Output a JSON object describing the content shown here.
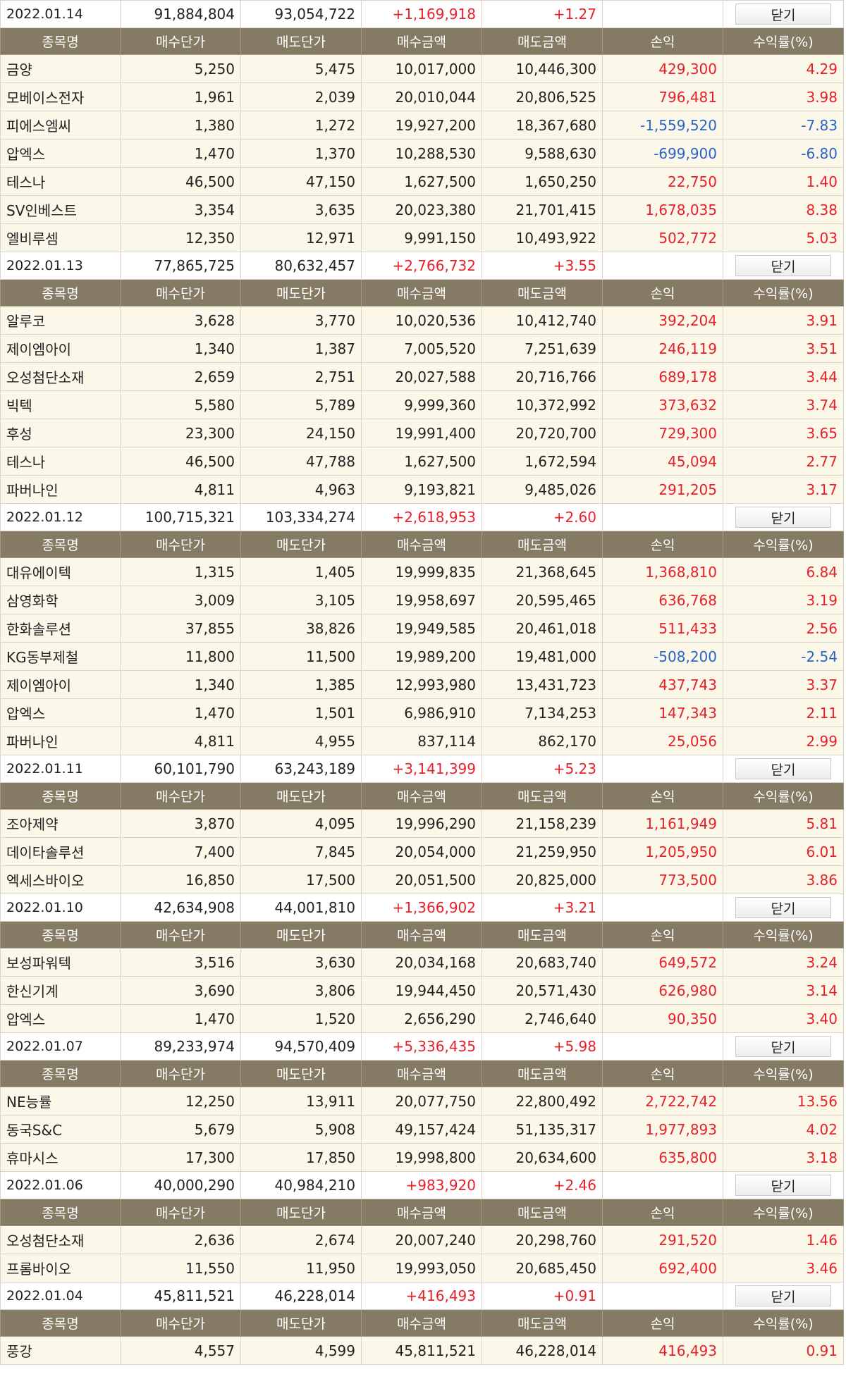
{
  "labels": {
    "close": "닫기",
    "headers": [
      "종목명",
      "매수단가",
      "매도단가",
      "매수금액",
      "매도금액",
      "손익",
      "수익률(%)"
    ]
  },
  "colors": {
    "positive": "#e8202a",
    "negative": "#2a64c8",
    "header_bg": "#857a63",
    "row_bg": "#fcf8e9"
  },
  "days": [
    {
      "date": "2022.01.14",
      "buy_total": "91,884,804",
      "sell_total": "93,054,722",
      "profit": "+1,169,918",
      "rate": "+1.27",
      "rows": [
        {
          "name": "금양",
          "buy_price": "5,250",
          "sell_price": "5,475",
          "buy_amount": "10,017,000",
          "sell_amount": "10,446,300",
          "profit": "429,300",
          "rate": "4.29"
        },
        {
          "name": "모베이스전자",
          "buy_price": "1,961",
          "sell_price": "2,039",
          "buy_amount": "20,010,044",
          "sell_amount": "20,806,525",
          "profit": "796,481",
          "rate": "3.98"
        },
        {
          "name": "피에스엠씨",
          "buy_price": "1,380",
          "sell_price": "1,272",
          "buy_amount": "19,927,200",
          "sell_amount": "18,367,680",
          "profit": "-1,559,520",
          "rate": "-7.83"
        },
        {
          "name": "압엑스",
          "buy_price": "1,470",
          "sell_price": "1,370",
          "buy_amount": "10,288,530",
          "sell_amount": "9,588,630",
          "profit": "-699,900",
          "rate": "-6.80"
        },
        {
          "name": "테스나",
          "buy_price": "46,500",
          "sell_price": "47,150",
          "buy_amount": "1,627,500",
          "sell_amount": "1,650,250",
          "profit": "22,750",
          "rate": "1.40"
        },
        {
          "name": "SV인베스트",
          "buy_price": "3,354",
          "sell_price": "3,635",
          "buy_amount": "20,023,380",
          "sell_amount": "21,701,415",
          "profit": "1,678,035",
          "rate": "8.38"
        },
        {
          "name": "엘비루셈",
          "buy_price": "12,350",
          "sell_price": "12,971",
          "buy_amount": "9,991,150",
          "sell_amount": "10,493,922",
          "profit": "502,772",
          "rate": "5.03"
        }
      ]
    },
    {
      "date": "2022.01.13",
      "buy_total": "77,865,725",
      "sell_total": "80,632,457",
      "profit": "+2,766,732",
      "rate": "+3.55",
      "rows": [
        {
          "name": "알루코",
          "buy_price": "3,628",
          "sell_price": "3,770",
          "buy_amount": "10,020,536",
          "sell_amount": "10,412,740",
          "profit": "392,204",
          "rate": "3.91"
        },
        {
          "name": "제이엠아이",
          "buy_price": "1,340",
          "sell_price": "1,387",
          "buy_amount": "7,005,520",
          "sell_amount": "7,251,639",
          "profit": "246,119",
          "rate": "3.51"
        },
        {
          "name": "오성첨단소재",
          "buy_price": "2,659",
          "sell_price": "2,751",
          "buy_amount": "20,027,588",
          "sell_amount": "20,716,766",
          "profit": "689,178",
          "rate": "3.44"
        },
        {
          "name": "빅텍",
          "buy_price": "5,580",
          "sell_price": "5,789",
          "buy_amount": "9,999,360",
          "sell_amount": "10,372,992",
          "profit": "373,632",
          "rate": "3.74"
        },
        {
          "name": "후성",
          "buy_price": "23,300",
          "sell_price": "24,150",
          "buy_amount": "19,991,400",
          "sell_amount": "20,720,700",
          "profit": "729,300",
          "rate": "3.65"
        },
        {
          "name": "테스나",
          "buy_price": "46,500",
          "sell_price": "47,788",
          "buy_amount": "1,627,500",
          "sell_amount": "1,672,594",
          "profit": "45,094",
          "rate": "2.77"
        },
        {
          "name": "파버나인",
          "buy_price": "4,811",
          "sell_price": "4,963",
          "buy_amount": "9,193,821",
          "sell_amount": "9,485,026",
          "profit": "291,205",
          "rate": "3.17"
        }
      ]
    },
    {
      "date": "2022.01.12",
      "buy_total": "100,715,321",
      "sell_total": "103,334,274",
      "profit": "+2,618,953",
      "rate": "+2.60",
      "rows": [
        {
          "name": "대유에이텍",
          "buy_price": "1,315",
          "sell_price": "1,405",
          "buy_amount": "19,999,835",
          "sell_amount": "21,368,645",
          "profit": "1,368,810",
          "rate": "6.84"
        },
        {
          "name": "삼영화학",
          "buy_price": "3,009",
          "sell_price": "3,105",
          "buy_amount": "19,958,697",
          "sell_amount": "20,595,465",
          "profit": "636,768",
          "rate": "3.19"
        },
        {
          "name": "한화솔루션",
          "buy_price": "37,855",
          "sell_price": "38,826",
          "buy_amount": "19,949,585",
          "sell_amount": "20,461,018",
          "profit": "511,433",
          "rate": "2.56"
        },
        {
          "name": "KG동부제철",
          "buy_price": "11,800",
          "sell_price": "11,500",
          "buy_amount": "19,989,200",
          "sell_amount": "19,481,000",
          "profit": "-508,200",
          "rate": "-2.54"
        },
        {
          "name": "제이엠아이",
          "buy_price": "1,340",
          "sell_price": "1,385",
          "buy_amount": "12,993,980",
          "sell_amount": "13,431,723",
          "profit": "437,743",
          "rate": "3.37"
        },
        {
          "name": "압엑스",
          "buy_price": "1,470",
          "sell_price": "1,501",
          "buy_amount": "6,986,910",
          "sell_amount": "7,134,253",
          "profit": "147,343",
          "rate": "2.11"
        },
        {
          "name": "파버나인",
          "buy_price": "4,811",
          "sell_price": "4,955",
          "buy_amount": "837,114",
          "sell_amount": "862,170",
          "profit": "25,056",
          "rate": "2.99"
        }
      ]
    },
    {
      "date": "2022.01.11",
      "buy_total": "60,101,790",
      "sell_total": "63,243,189",
      "profit": "+3,141,399",
      "rate": "+5.23",
      "rows": [
        {
          "name": "조아제약",
          "buy_price": "3,870",
          "sell_price": "4,095",
          "buy_amount": "19,996,290",
          "sell_amount": "21,158,239",
          "profit": "1,161,949",
          "rate": "5.81"
        },
        {
          "name": "데이타솔루션",
          "buy_price": "7,400",
          "sell_price": "7,845",
          "buy_amount": "20,054,000",
          "sell_amount": "21,259,950",
          "profit": "1,205,950",
          "rate": "6.01"
        },
        {
          "name": "엑세스바이오",
          "buy_price": "16,850",
          "sell_price": "17,500",
          "buy_amount": "20,051,500",
          "sell_amount": "20,825,000",
          "profit": "773,500",
          "rate": "3.86"
        }
      ]
    },
    {
      "date": "2022.01.10",
      "buy_total": "42,634,908",
      "sell_total": "44,001,810",
      "profit": "+1,366,902",
      "rate": "+3.21",
      "rows": [
        {
          "name": "보성파워텍",
          "buy_price": "3,516",
          "sell_price": "3,630",
          "buy_amount": "20,034,168",
          "sell_amount": "20,683,740",
          "profit": "649,572",
          "rate": "3.24"
        },
        {
          "name": "한신기계",
          "buy_price": "3,690",
          "sell_price": "3,806",
          "buy_amount": "19,944,450",
          "sell_amount": "20,571,430",
          "profit": "626,980",
          "rate": "3.14"
        },
        {
          "name": "압엑스",
          "buy_price": "1,470",
          "sell_price": "1,520",
          "buy_amount": "2,656,290",
          "sell_amount": "2,746,640",
          "profit": "90,350",
          "rate": "3.40"
        }
      ]
    },
    {
      "date": "2022.01.07",
      "buy_total": "89,233,974",
      "sell_total": "94,570,409",
      "profit": "+5,336,435",
      "rate": "+5.98",
      "rows": [
        {
          "name": "NE능률",
          "buy_price": "12,250",
          "sell_price": "13,911",
          "buy_amount": "20,077,750",
          "sell_amount": "22,800,492",
          "profit": "2,722,742",
          "rate": "13.56"
        },
        {
          "name": "동국S&C",
          "buy_price": "5,679",
          "sell_price": "5,908",
          "buy_amount": "49,157,424",
          "sell_amount": "51,135,317",
          "profit": "1,977,893",
          "rate": "4.02"
        },
        {
          "name": "휴마시스",
          "buy_price": "17,300",
          "sell_price": "17,850",
          "buy_amount": "19,998,800",
          "sell_amount": "20,634,600",
          "profit": "635,800",
          "rate": "3.18"
        }
      ]
    },
    {
      "date": "2022.01.06",
      "buy_total": "40,000,290",
      "sell_total": "40,984,210",
      "profit": "+983,920",
      "rate": "+2.46",
      "rows": [
        {
          "name": "오성첨단소재",
          "buy_price": "2,636",
          "sell_price": "2,674",
          "buy_amount": "20,007,240",
          "sell_amount": "20,298,760",
          "profit": "291,520",
          "rate": "1.46"
        },
        {
          "name": "프롬바이오",
          "buy_price": "11,550",
          "sell_price": "11,950",
          "buy_amount": "19,993,050",
          "sell_amount": "20,685,450",
          "profit": "692,400",
          "rate": "3.46"
        }
      ]
    },
    {
      "date": "2022.01.04",
      "buy_total": "45,811,521",
      "sell_total": "46,228,014",
      "profit": "+416,493",
      "rate": "+0.91",
      "rows": [
        {
          "name": "풍강",
          "buy_price": "4,557",
          "sell_price": "4,599",
          "buy_amount": "45,811,521",
          "sell_amount": "46,228,014",
          "profit": "416,493",
          "rate": "0.91"
        }
      ]
    }
  ]
}
